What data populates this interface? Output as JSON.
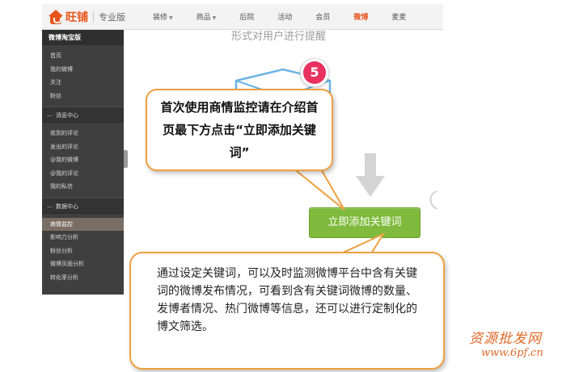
{
  "header": {
    "logo_text": "旺铺",
    "edition": "专业版",
    "nav": [
      {
        "label": "装修",
        "dropdown": true,
        "active": false
      },
      {
        "label": "商品",
        "dropdown": true,
        "active": false
      },
      {
        "label": "后院",
        "dropdown": false,
        "active": false
      },
      {
        "label": "活动",
        "dropdown": false,
        "active": false
      },
      {
        "label": "会员",
        "dropdown": false,
        "active": false
      },
      {
        "label": "微博",
        "dropdown": false,
        "active": true
      },
      {
        "label": "麦麦",
        "dropdown": false,
        "active": false
      }
    ]
  },
  "sidebar": {
    "title": "微博淘宝版",
    "items_top": [
      "首页",
      "我的微博",
      "关注",
      "粉丝"
    ],
    "section_messages": "消息中心",
    "items_messages": [
      "收到的评论",
      "发出的评论",
      "@我的微博",
      "@我的评论",
      "我的私信"
    ],
    "section_data": "数据中心",
    "items_data": [
      "商情监控",
      "影响力分析",
      "粉丝分析",
      "微博页面分析",
      "转化率分析"
    ],
    "active_item": "商情监控"
  },
  "main": {
    "top_text": "形式对用户进行提醒",
    "step_number": "5",
    "add_keyword_button": "立即添加关键词"
  },
  "callouts": {
    "top": "首次使用商情监控请在介绍首页最下方点击“立即添加关键词”",
    "bottom": "通过设定关键词，可以及时监测微博平台中含有关键词的微博发布情况，可看到含有关键词微博的数量、发博者情况、热门微博等信息，还可以进行定制化的博文筛选。"
  },
  "watermark": {
    "text": "资源批发网",
    "url": "www.6pf.cn"
  },
  "colors": {
    "accent": "#e8551c",
    "button_green": "#7fba3c",
    "callout_border": "#f0a040",
    "badge_pink": "#e8315e",
    "sidebar_bg": "#3f3f3f"
  }
}
